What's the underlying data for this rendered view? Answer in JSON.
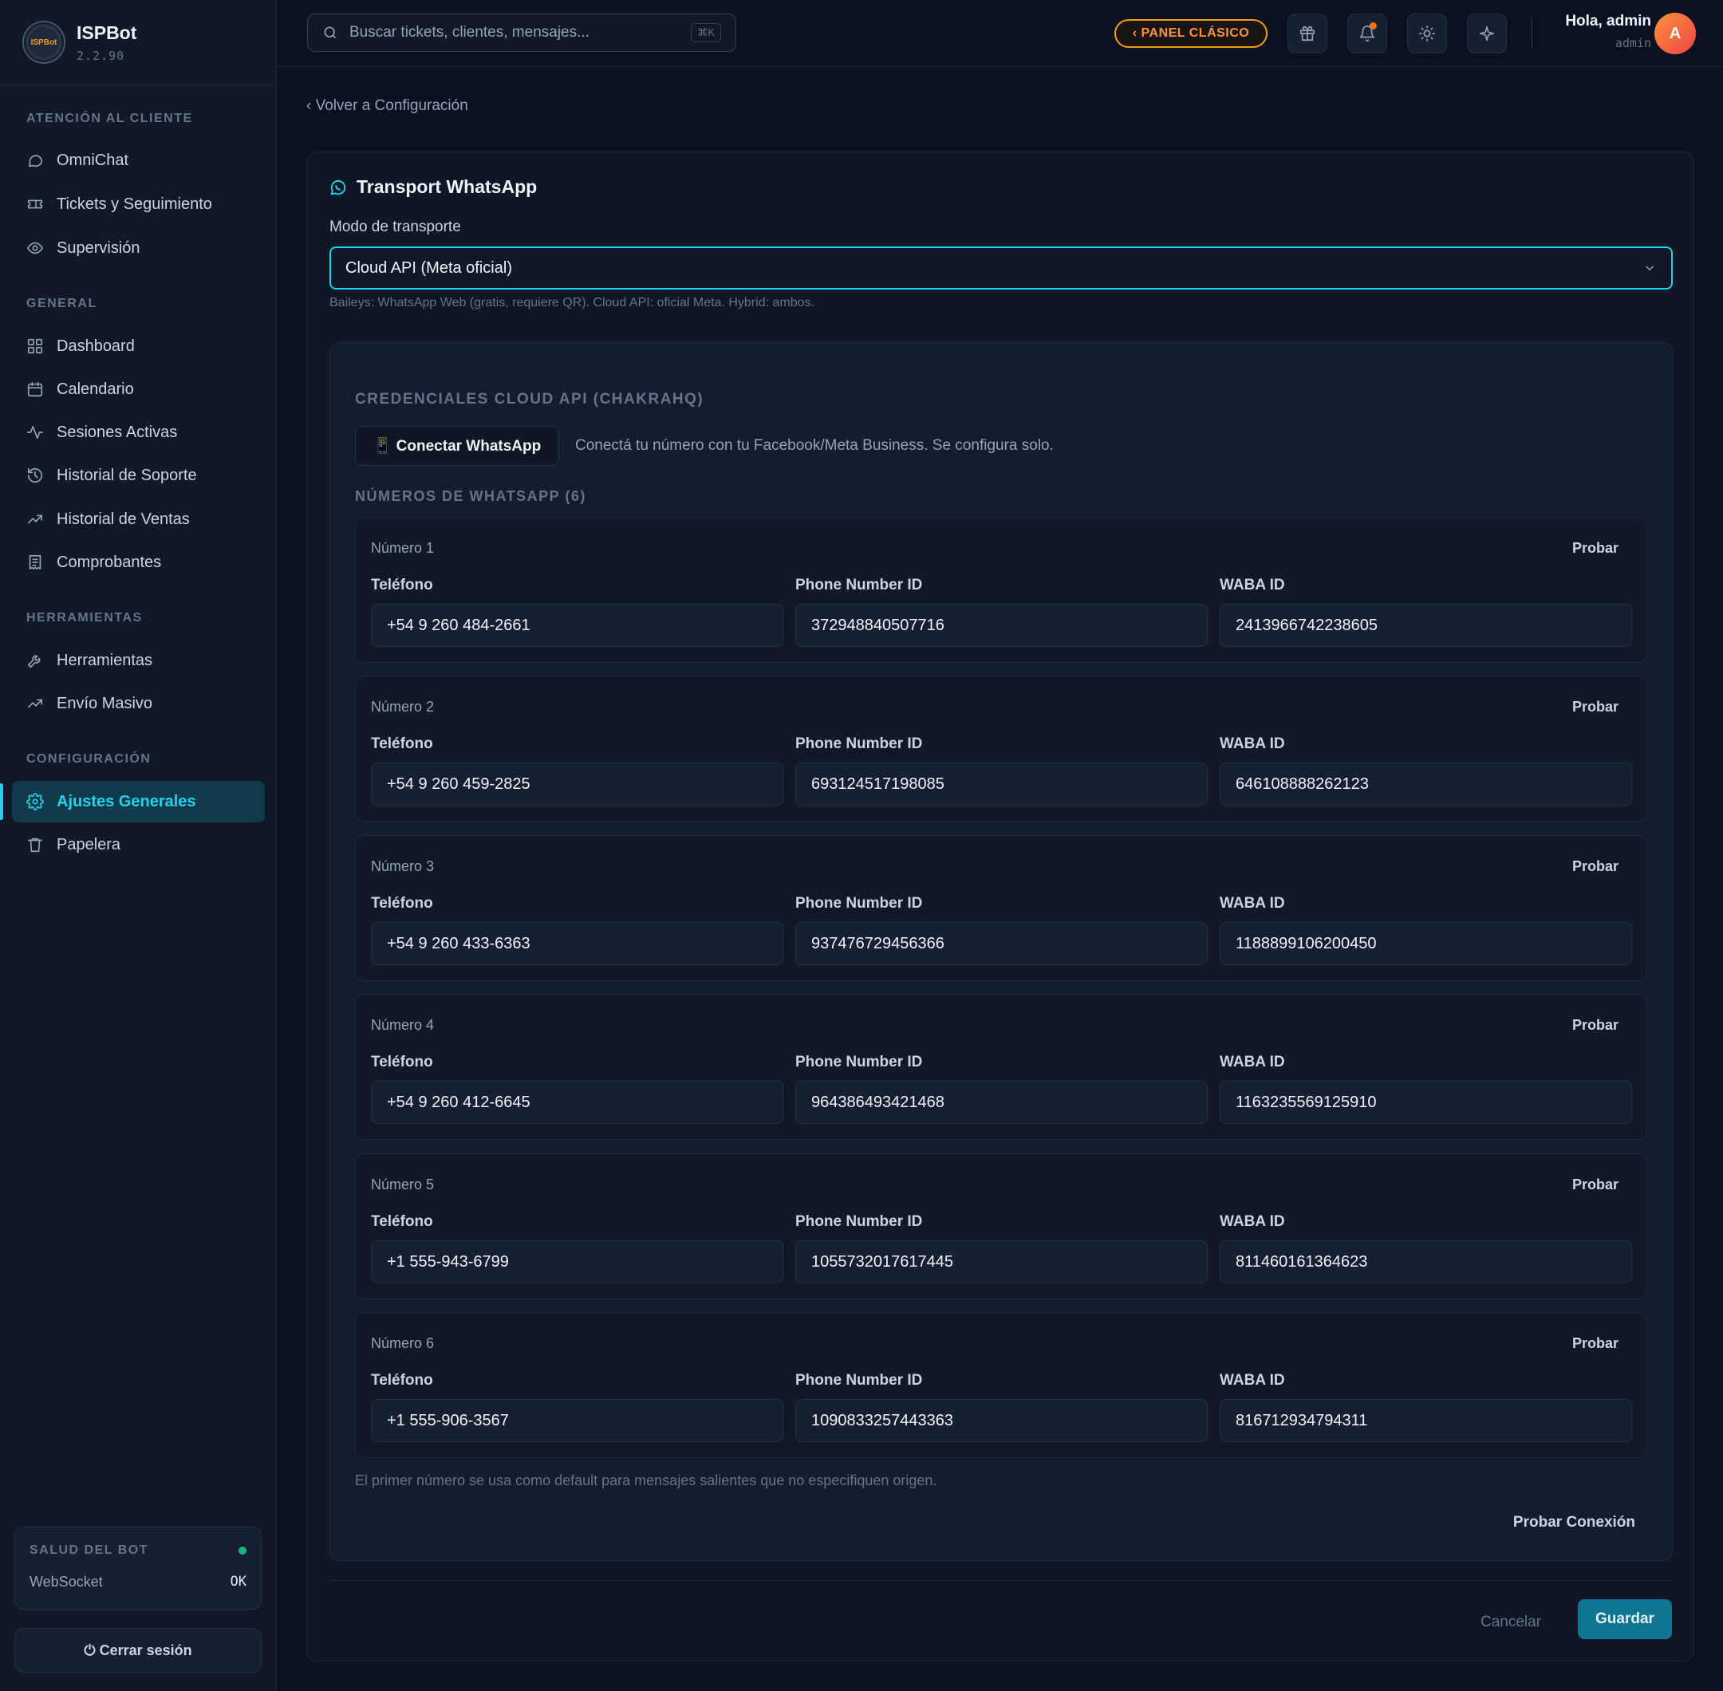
{
  "brand": {
    "name": "ISPBot",
    "version": "2.2.90",
    "logo_text": "ISPBot"
  },
  "sidebar": {
    "sections": [
      {
        "title": "ATENCIÓN AL CLIENTE",
        "items": [
          {
            "label": "OmniChat",
            "icon": "chat-icon"
          },
          {
            "label": "Tickets y Seguimiento",
            "icon": "ticket-icon"
          },
          {
            "label": "Supervisión",
            "icon": "eye-icon"
          }
        ]
      },
      {
        "title": "GENERAL",
        "items": [
          {
            "label": "Dashboard",
            "icon": "grid-icon"
          },
          {
            "label": "Calendario",
            "icon": "calendar-icon"
          },
          {
            "label": "Sesiones Activas",
            "icon": "activity-icon"
          },
          {
            "label": "Historial de Soporte",
            "icon": "history-icon"
          },
          {
            "label": "Historial de Ventas",
            "icon": "trending-icon"
          },
          {
            "label": "Comprobantes",
            "icon": "receipt-icon"
          }
        ]
      },
      {
        "title": "HERRAMIENTAS",
        "items": [
          {
            "label": "Herramientas",
            "icon": "wrench-icon"
          },
          {
            "label": "Envío Masivo",
            "icon": "trending-icon"
          }
        ]
      },
      {
        "title": "CONFIGURACIÓN",
        "items": [
          {
            "label": "Ajustes Generales",
            "icon": "gear-icon",
            "active": true
          },
          {
            "label": "Papelera",
            "icon": "trash-icon"
          }
        ]
      }
    ],
    "health": {
      "title": "SALUD DEL BOT",
      "label": "WebSocket",
      "value": "OK",
      "status_color": "#10b981"
    },
    "logout_label": "⏻ Cerrar sesión"
  },
  "header": {
    "search_placeholder": "Buscar tickets, clientes, mensajes...",
    "search_shortcut": "⌘K",
    "classic_label": "‹ PANEL CLÁSICO",
    "greeting": "Hola, admin",
    "role": "admin",
    "avatar_letter": "A"
  },
  "main": {
    "back_link": "‹ Volver a Configuración",
    "card_title": "Transport WhatsApp",
    "mode_label": "Modo de transporte",
    "mode_value": "Cloud API (Meta oficial)",
    "mode_hint": "Baileys: WhatsApp Web (gratis, requiere QR). Cloud API: oficial Meta. Hybrid: ambos.",
    "credentials_title": "CREDENCIALES CLOUD API (CHAKRAHQ)",
    "connect_label": "📱 Conectar WhatsApp",
    "connect_hint": "Conectá tu número con tu Facebook/Meta Business. Se configura solo.",
    "numbers_title": "NÚMEROS DE WHATSAPP (6)",
    "field_labels": {
      "phone": "Teléfono",
      "phone_id": "Phone Number ID",
      "waba": "WABA ID"
    },
    "test_label": "Probar",
    "numbers": [
      {
        "title": "Número 1",
        "phone": "+54 9 260 484-2661",
        "phone_id": "372948840507716",
        "waba": "2413966742238605"
      },
      {
        "title": "Número 2",
        "phone": "+54 9 260 459-2825",
        "phone_id": "693124517198085",
        "waba": "646108888262123"
      },
      {
        "title": "Número 3",
        "phone": "+54 9 260 433-6363",
        "phone_id": "937476729456366",
        "waba": "1188899106200450"
      },
      {
        "title": "Número 4",
        "phone": "+54 9 260 412-6645",
        "phone_id": "964386493421468",
        "waba": "1163235569125910"
      },
      {
        "title": "Número 5",
        "phone": "+1 555-943-6799",
        "phone_id": "1055732017617445",
        "waba": "811460161364623"
      },
      {
        "title": "Número 6",
        "phone": "+1 555-906-3567",
        "phone_id": "1090833257443363",
        "waba": "816712934794311"
      }
    ],
    "footnote": "El primer número se usa como default para mensajes salientes que no especifiquen origen.",
    "test_connection_label": "Probar Conexión",
    "cancel_label": "Cancelar",
    "save_label": "Guardar"
  },
  "colors": {
    "accent": "#22d3ee",
    "warning": "#f59e0b",
    "primary_button": "#0e7490"
  }
}
